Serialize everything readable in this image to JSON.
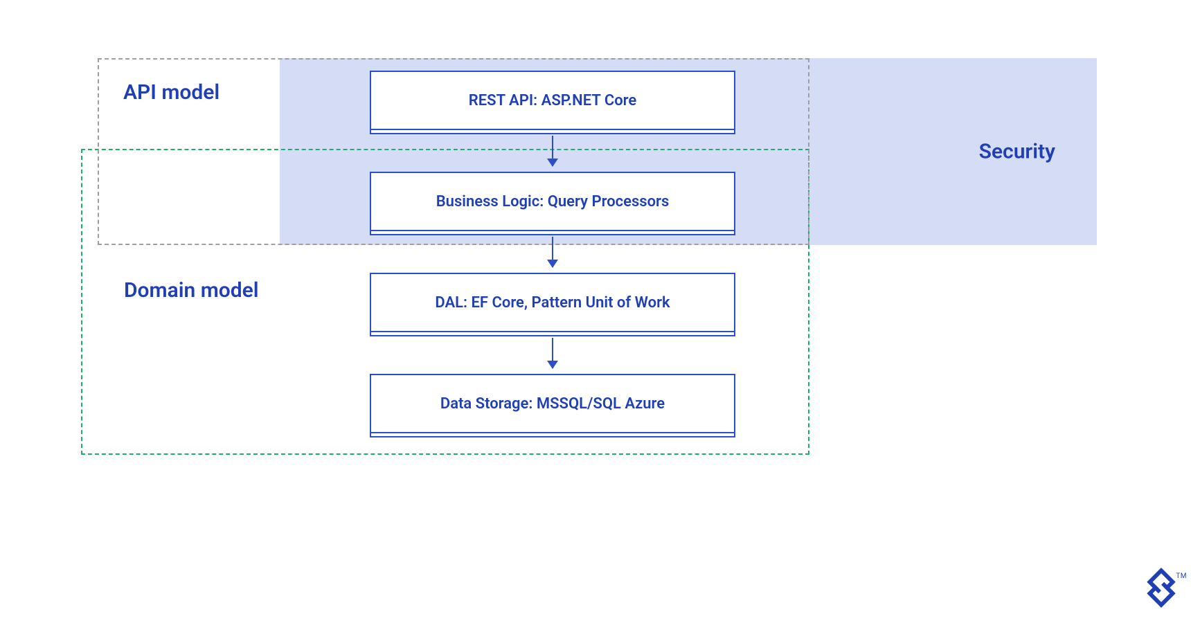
{
  "regions": {
    "api_model": {
      "label": "API model"
    },
    "domain_model": {
      "label": "Domain model"
    },
    "security": {
      "label": "Security"
    }
  },
  "layers": [
    {
      "label": "REST API: ASP.NET Core"
    },
    {
      "label": "Business Logic: Query Processors"
    },
    {
      "label": "DAL: EF Core, Pattern Unit of Work"
    },
    {
      "label": "Data Storage: MSSQL/SQL Azure"
    }
  ],
  "flow": [
    {
      "from": 0,
      "to": 1
    },
    {
      "from": 1,
      "to": 2
    },
    {
      "from": 2,
      "to": 3
    }
  ],
  "colors": {
    "primary_blue": "#1f3fb5",
    "box_border_blue": "#2a4fc6",
    "security_fill": "#d5dcf6",
    "api_dash": "#9e9e9e",
    "domain_dash": "#18b06b"
  },
  "logo": {
    "name": "toptal-mark",
    "trademark": "TM"
  }
}
